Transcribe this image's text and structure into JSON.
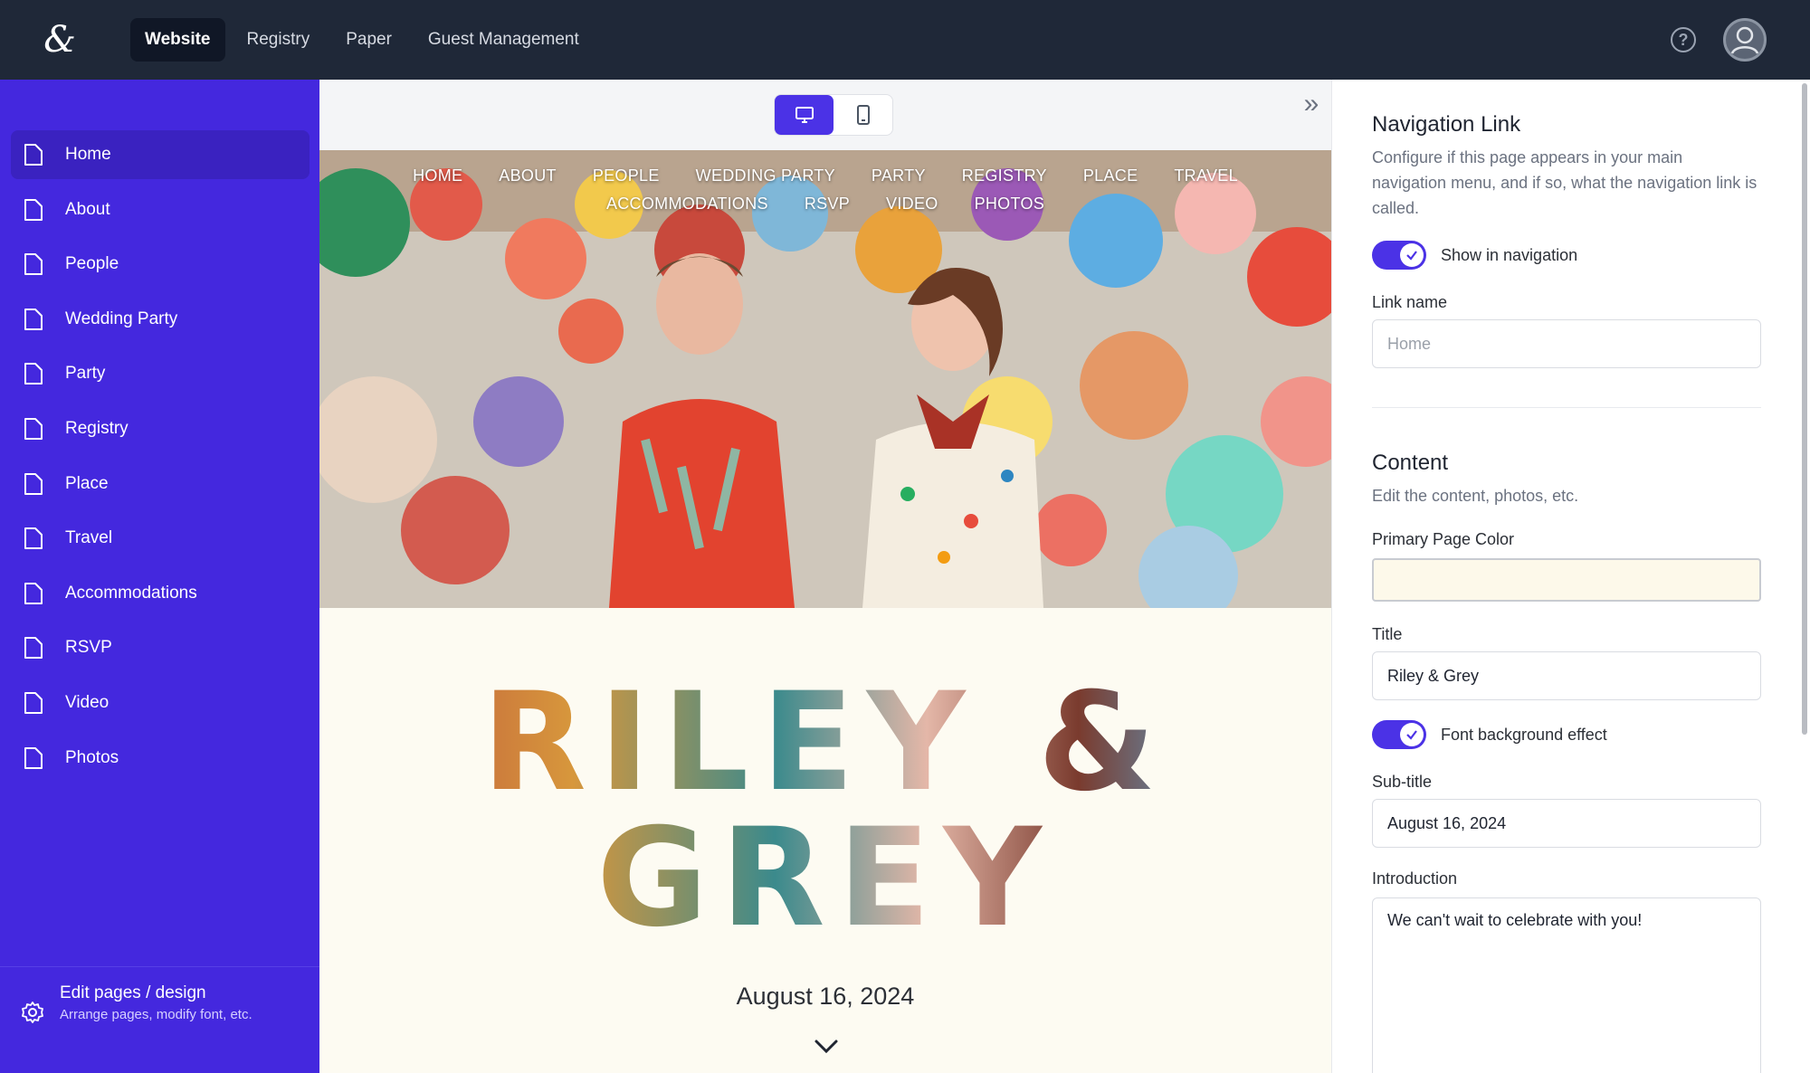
{
  "topbar": {
    "logo_icon": "ampersand-logo-icon",
    "nav": [
      {
        "label": "Website",
        "active": true
      },
      {
        "label": "Registry",
        "active": false
      },
      {
        "label": "Paper",
        "active": false
      },
      {
        "label": "Guest Management",
        "active": false
      }
    ],
    "help_icon": "question-circle-icon",
    "avatar_icon": "user-avatar-icon"
  },
  "sidebar": {
    "items": [
      {
        "label": "Home",
        "active": true
      },
      {
        "label": "About"
      },
      {
        "label": "People"
      },
      {
        "label": "Wedding Party"
      },
      {
        "label": "Party"
      },
      {
        "label": "Registry"
      },
      {
        "label": "Place"
      },
      {
        "label": "Travel"
      },
      {
        "label": "Accommodations"
      },
      {
        "label": "RSVP"
      },
      {
        "label": "Video"
      },
      {
        "label": "Photos"
      }
    ],
    "footer": {
      "title": "Edit pages / design",
      "subtitle": "Arrange pages, modify font, etc."
    }
  },
  "preview": {
    "device_modes": [
      "desktop",
      "mobile"
    ],
    "active_device": "desktop",
    "site_nav_row1": [
      "HOME",
      "ABOUT",
      "PEOPLE",
      "WEDDING PARTY",
      "PARTY",
      "REGISTRY",
      "PLACE",
      "TRAVEL"
    ],
    "site_nav_row2": [
      "ACCOMMODATIONS",
      "RSVP",
      "VIDEO",
      "PHOTOS"
    ],
    "title_line1": "RILEY &",
    "title_line2": "GREY",
    "date": "August 16, 2024"
  },
  "panel": {
    "nav_section": {
      "title": "Navigation Link",
      "description": "Configure if this page appears in your main navigation menu, and if so, what the navigation link is called.",
      "show_in_nav_label": "Show in navigation",
      "show_in_nav": true,
      "link_name_label": "Link name",
      "link_name_placeholder": "Home"
    },
    "content_section": {
      "title": "Content",
      "description": "Edit the content, photos, etc.",
      "primary_color_label": "Primary Page Color",
      "primary_color": "#fdf9ea",
      "title_label": "Title",
      "title_value": "Riley & Grey",
      "font_bg_label": "Font background effect",
      "font_bg": true,
      "subtitle_label": "Sub-title",
      "subtitle_value": "August 16, 2024",
      "intro_label": "Introduction",
      "intro_value": "We can't wait to celebrate with you!"
    }
  },
  "colors": {
    "topbar": "#1f2838",
    "sidebar": "#4428de",
    "accent": "#4b32e6",
    "page_bg": "#fdfbf2"
  }
}
